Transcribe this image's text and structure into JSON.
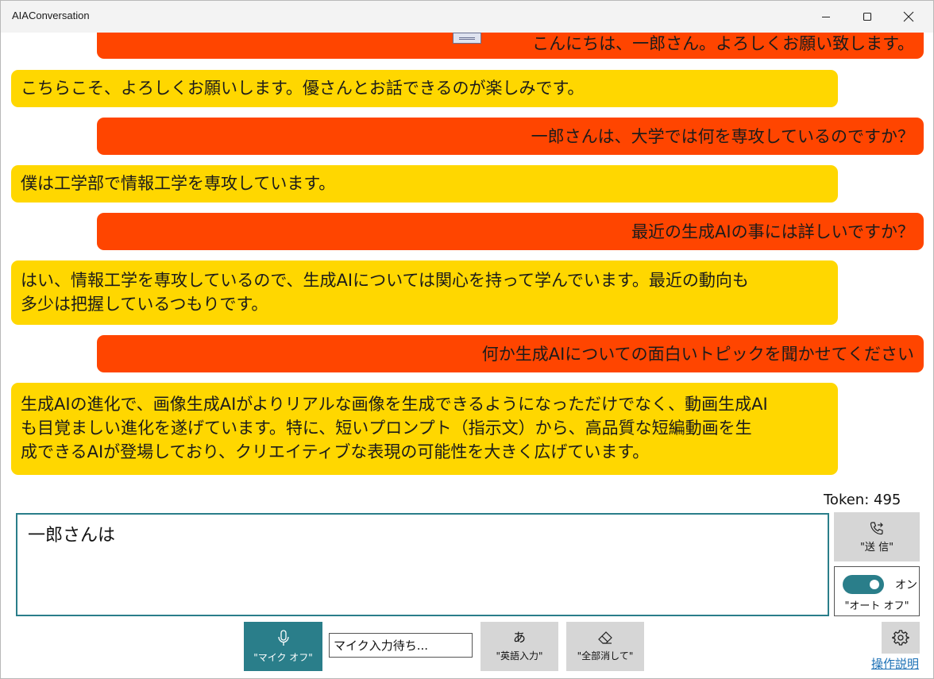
{
  "window": {
    "title": "AIAConversation"
  },
  "messages": [
    {
      "role": "user",
      "text": "こんにちは、一郎さん。よろしくお願い致します。"
    },
    {
      "role": "ai",
      "text": "こちらこそ、よろしくお願いします。優さんとお話できるのが楽しみです。"
    },
    {
      "role": "user",
      "text": "一郎さんは、大学では何を専攻しているのですか？"
    },
    {
      "role": "ai",
      "text": "僕は工学部で情報工学を専攻しています。"
    },
    {
      "role": "user",
      "text": "最近の生成AIの事には詳しいですか？"
    },
    {
      "role": "ai",
      "text": "はい、情報工学を専攻しているので、生成AIについては関心を持って学んでいます。最近の動向も\n多少は把握しているつもりです。"
    },
    {
      "role": "user",
      "text": "何か生成AIについての面白いトピックを聞かせてください"
    },
    {
      "role": "ai",
      "text": "生成AIの進化で、画像生成AIがよりリアルな画像を生成できるようになっただけでなく、動画生成AI\nも目覚ましい進化を遂げています。特に、短いプロンプト（指示文）から、高品質な短編動画を生\n成できるAIが登場しており、クリエイティブな表現の可能性を大きく広げています。"
    }
  ],
  "token_label": "Token: 495",
  "input": {
    "value": "一郎さんは"
  },
  "send_button": {
    "label": "\"送 信\"",
    "icon": "phone-forward-icon"
  },
  "auto_toggle": {
    "state_label": "オン",
    "caption": "\"オート オフ\"",
    "on": true
  },
  "mic_button": {
    "label": "\"マイク オフ\"",
    "icon": "microphone-icon"
  },
  "mic_status": {
    "value": "マイク入力待ち..."
  },
  "english_button": {
    "glyph": "あ",
    "label": "\"英語入力\""
  },
  "clear_button": {
    "label": "\"全部消して\"",
    "icon": "eraser-icon"
  },
  "settings_button": {
    "icon": "gear-icon"
  },
  "help_link": {
    "label": "操作説明"
  },
  "colors": {
    "user_bubble": "#ff4500",
    "ai_bubble": "#ffd700",
    "accent": "#2a7e8a",
    "button_gray": "#d6d6d6",
    "link": "#1a6fb5"
  }
}
